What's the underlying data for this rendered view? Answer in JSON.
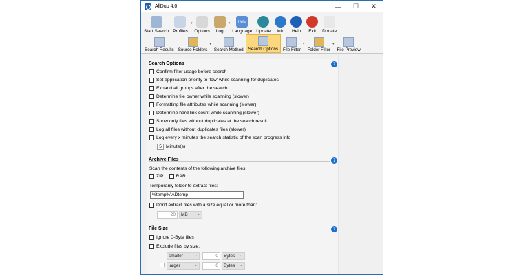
{
  "window": {
    "title": "AllDup 4.0"
  },
  "toolbar": [
    {
      "id": "start-search",
      "label": "Start Search",
      "color": "#9fb7d6",
      "dropdown": false
    },
    {
      "id": "profiles",
      "label": "Profiles",
      "color": "#c9d5e6",
      "dropdown": true
    },
    {
      "id": "options",
      "label": "Options",
      "color": "#d8d8d8",
      "dropdown": false
    },
    {
      "id": "log",
      "label": "Log",
      "color": "#c9a86c",
      "dropdown": true
    },
    {
      "id": "language",
      "label": "Language",
      "color": "#5a8fd8",
      "dropdown": false
    },
    {
      "id": "update",
      "label": "Update",
      "color": "#2a8a9a",
      "dropdown": false
    },
    {
      "id": "info",
      "label": "Info",
      "color": "#2b79c9",
      "dropdown": false
    },
    {
      "id": "help",
      "label": "Help",
      "color": "#1e5fb7",
      "dropdown": false
    },
    {
      "id": "exit",
      "label": "Exit",
      "color": "#d13a2a",
      "dropdown": false
    },
    {
      "id": "donate",
      "label": "Donate",
      "color": "#e8e8e8",
      "dropdown": false
    }
  ],
  "language_badge": "Hello",
  "tabs": [
    {
      "id": "search-results",
      "label": "Search Results",
      "active": false,
      "dropdown": false
    },
    {
      "id": "source-folders",
      "label": "Source Folders",
      "active": false,
      "dropdown": true
    },
    {
      "id": "search-method",
      "label": "Search Method",
      "active": false,
      "dropdown": false
    },
    {
      "id": "search-options",
      "label": "Search Options",
      "active": true,
      "dropdown": false
    },
    {
      "id": "file-filter",
      "label": "File Filter",
      "active": false,
      "dropdown": true
    },
    {
      "id": "folder-filter",
      "label": "Folder Filter",
      "active": false,
      "dropdown": true
    },
    {
      "id": "file-preview",
      "label": "File Preview",
      "active": false,
      "dropdown": false
    }
  ],
  "search_options": {
    "title": "Search Options",
    "items": [
      "Confirm filter usage before search",
      "Set application priority to 'low' while scanning for duplicates",
      "Expand all groups after the search",
      "Determine file owner while scanning (slower)",
      "Formatting file attributes while scanning (slower)",
      "Determine hard link count while scanning (slower)",
      "Show only files without duplicates at the search result",
      "Log all files without duplicates files (slower)",
      "Log every x minutes the search statistic of the scan progress info"
    ],
    "interval_value": "5",
    "interval_unit": "Minute(s)"
  },
  "archive_files": {
    "title": "Archive Files",
    "scan_label": "Scan the contents of the following archive files:",
    "zip": "ZIP",
    "rar": "RAR",
    "temp_label": "Temporarily folder to extract files:",
    "temp_value": "%temp%\\ADtemp",
    "size_label": "Don't extract files with a size equal or more than:",
    "size_value": "20",
    "size_unit": "MB"
  },
  "file_size": {
    "title": "File Size",
    "ignore_zero": "Ignore 0-Byte files",
    "exclude_label": "Exclude files by size:",
    "rule1": {
      "op": "smaller",
      "value": "0",
      "unit": "Bytes"
    },
    "rule2": {
      "op": "larger",
      "value": "0",
      "unit": "Bytes"
    }
  },
  "colors": {
    "help": "#1c6fd1",
    "active_tab": "#fbd77d",
    "border": "#2b6cb0"
  }
}
